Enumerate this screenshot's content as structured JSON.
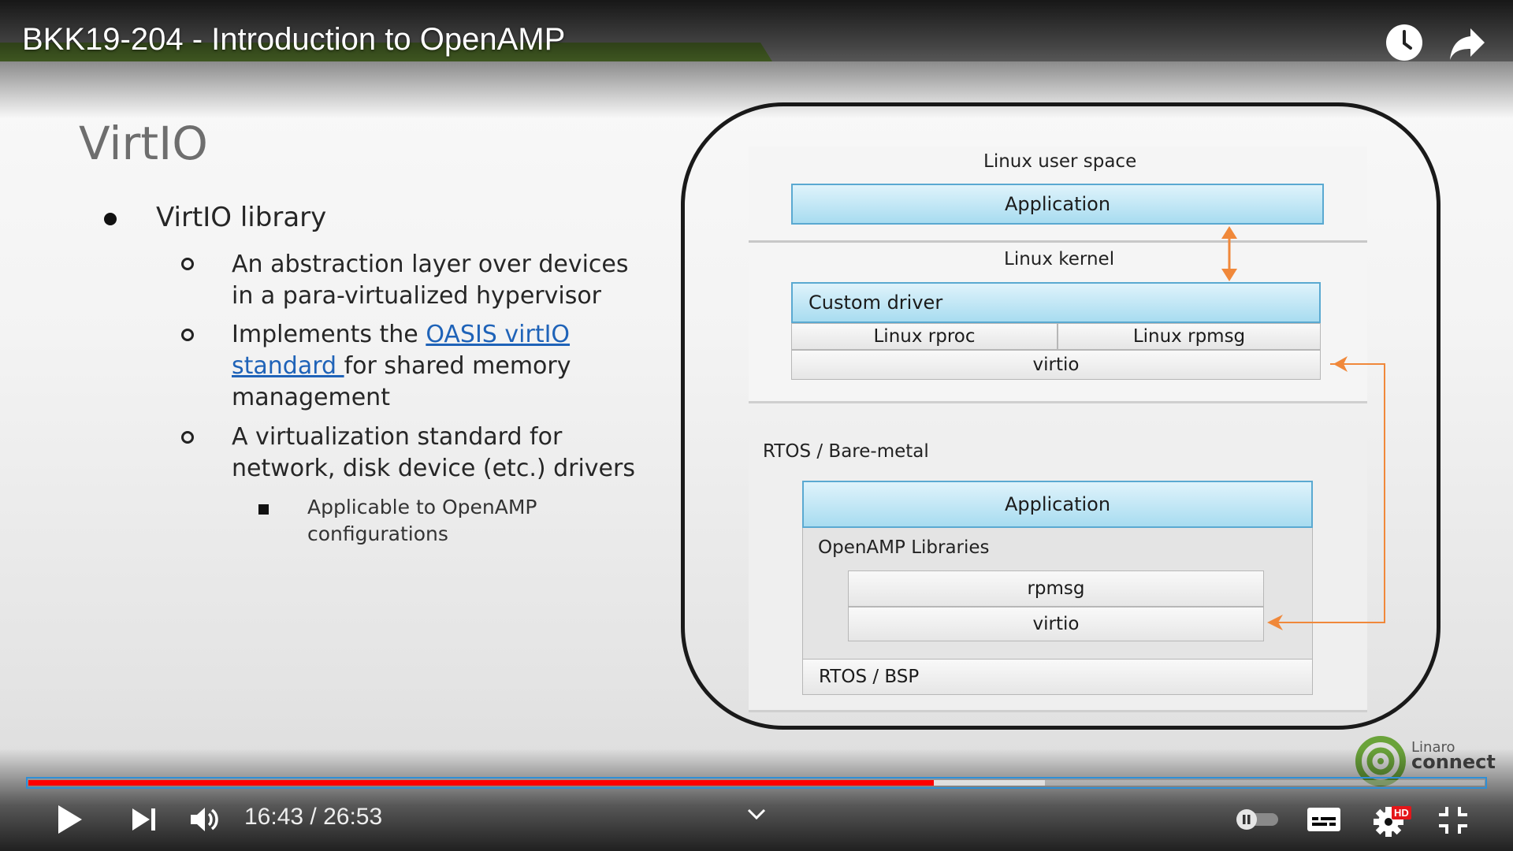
{
  "video": {
    "title": "BKK19-204 - Introduction to OpenAMP",
    "current_time": "16:43",
    "duration": "26:53",
    "time_text": "16:43 / 26:53",
    "progress_fraction": 0.622,
    "buffered_fraction": 0.698,
    "hd_badge": "HD",
    "accent_color": "#ff0000"
  },
  "slide": {
    "heading": "VirtIO",
    "bullet": "VirtIO library",
    "sub_bullets": [
      {
        "text": "An abstraction layer over devices in a para-virtualized hypervisor"
      },
      {
        "text_before": "Implements the ",
        "link": "OASIS virtIO standard ",
        "text_after": "for shared memory management"
      },
      {
        "text": "A virtualization standard for network, disk device (etc.) drivers"
      }
    ],
    "sub_sub_bullet": "Applicable to OpenAMP configurations"
  },
  "diagram": {
    "linux_user_space_label": "Linux user space",
    "linux_application": "Application",
    "linux_kernel_label": "Linux kernel",
    "custom_driver": "Custom driver",
    "linux_rproc": "Linux rproc",
    "linux_rpmsg": "Linux rpmsg",
    "linux_virtio": "virtio",
    "rtos_label": "RTOS / Bare-metal",
    "rtos_application": "Application",
    "openamp_libraries": "OpenAMP Libraries",
    "rpmsg": "rpmsg",
    "rtos_virtio": "virtio",
    "rtos_bsp": "RTOS / BSP",
    "arrow_color": "#f0883a"
  },
  "logo": {
    "line1": "Linaro",
    "line2": "connect"
  },
  "icons": {
    "clock": "clock-icon",
    "share": "share-icon",
    "play": "play-icon",
    "next": "next-icon",
    "volume": "volume-icon",
    "chevron": "chevron-down-icon",
    "captions": "captions-icon",
    "settings": "gear-icon",
    "exit_fullscreen": "exit-fullscreen-icon"
  }
}
